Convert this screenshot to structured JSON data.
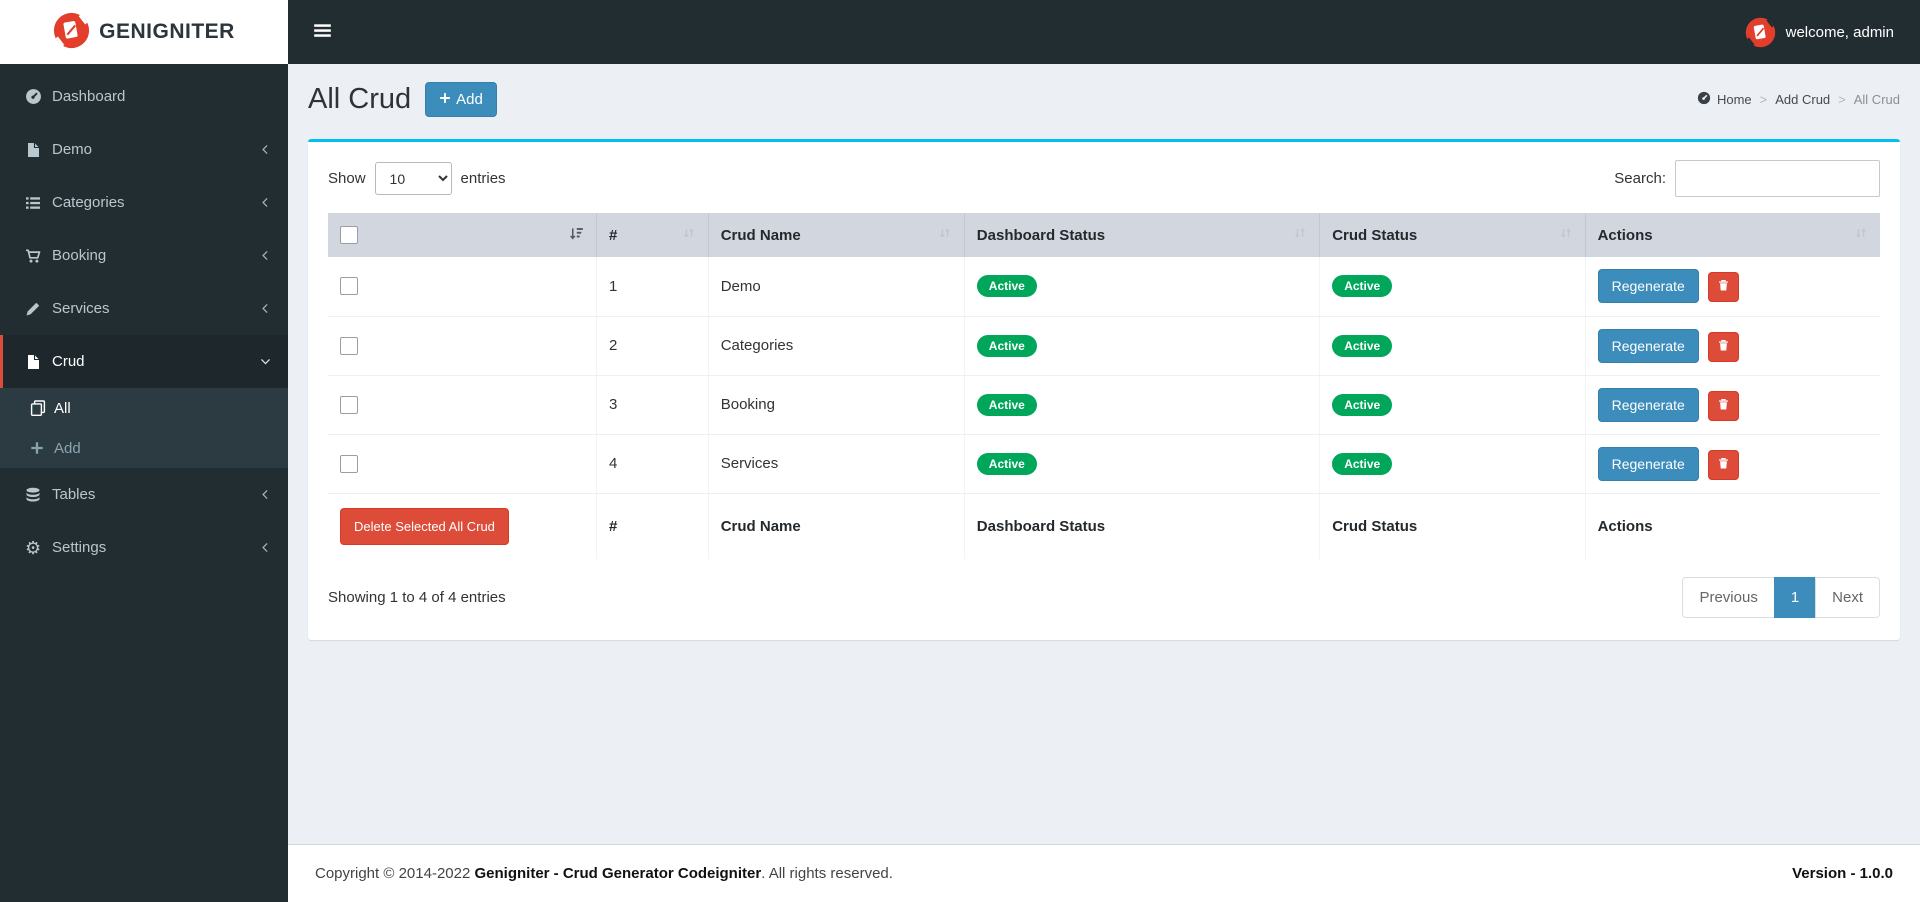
{
  "brand": {
    "name": "GENIGNITER"
  },
  "navbar": {
    "welcome_text": "welcome, admin"
  },
  "sidebar": {
    "items": [
      {
        "label": "Dashboard"
      },
      {
        "label": "Demo"
      },
      {
        "label": "Categories"
      },
      {
        "label": "Booking"
      },
      {
        "label": "Services"
      },
      {
        "label": "Crud"
      },
      {
        "label": "Tables"
      },
      {
        "label": "Settings"
      }
    ],
    "crud_children": [
      {
        "label": "All"
      },
      {
        "label": "Add"
      }
    ]
  },
  "page": {
    "title": "All Crud",
    "add_button_label": "Add",
    "breadcrumb_separator": ">",
    "breadcrumb": [
      {
        "label": "Home"
      },
      {
        "label": "Add Crud"
      },
      {
        "label": "All Crud"
      }
    ]
  },
  "table": {
    "show_label": "Show",
    "page_length": "10",
    "entries_label": "entries",
    "search_label": "Search:",
    "headers": [
      "#",
      "Crud Name",
      "Dashboard Status",
      "Crud Status",
      "Actions"
    ],
    "rows": [
      {
        "num": "1",
        "name": "Demo",
        "dashboard_status": "Active",
        "crud_status": "Active"
      },
      {
        "num": "2",
        "name": "Categories",
        "dashboard_status": "Active",
        "crud_status": "Active"
      },
      {
        "num": "3",
        "name": "Booking",
        "dashboard_status": "Active",
        "crud_status": "Active"
      },
      {
        "num": "4",
        "name": "Services",
        "dashboard_status": "Active",
        "crud_status": "Active"
      }
    ],
    "regenerate_label": "Regenerate",
    "delete_selected_label": "Delete Selected All Crud",
    "footer_headers": [
      "#",
      "Crud Name",
      "Dashboard Status",
      "Crud Status",
      "Actions"
    ],
    "info_text": "Showing 1 to 4 of 4 entries",
    "pagination": {
      "previous_label": "Previous",
      "current_page": "1",
      "next_label": "Next"
    }
  },
  "footer": {
    "copyright_prefix": "Copyright © 2014-2022 ",
    "copyright_brand": "Genigniter - Crud Generator Codeigniter",
    "copyright_suffix": ". All rights reserved.",
    "version": "Version - 1.0.0"
  },
  "colors": {
    "sidebar_bg": "#222d32",
    "accent_red": "#dd4b39",
    "logo_red": "#e23e2b",
    "primary_blue": "#3c8dbc",
    "success_green": "#00a65a",
    "box_top_border": "#00c0ef",
    "content_bg": "#ecf0f5"
  }
}
